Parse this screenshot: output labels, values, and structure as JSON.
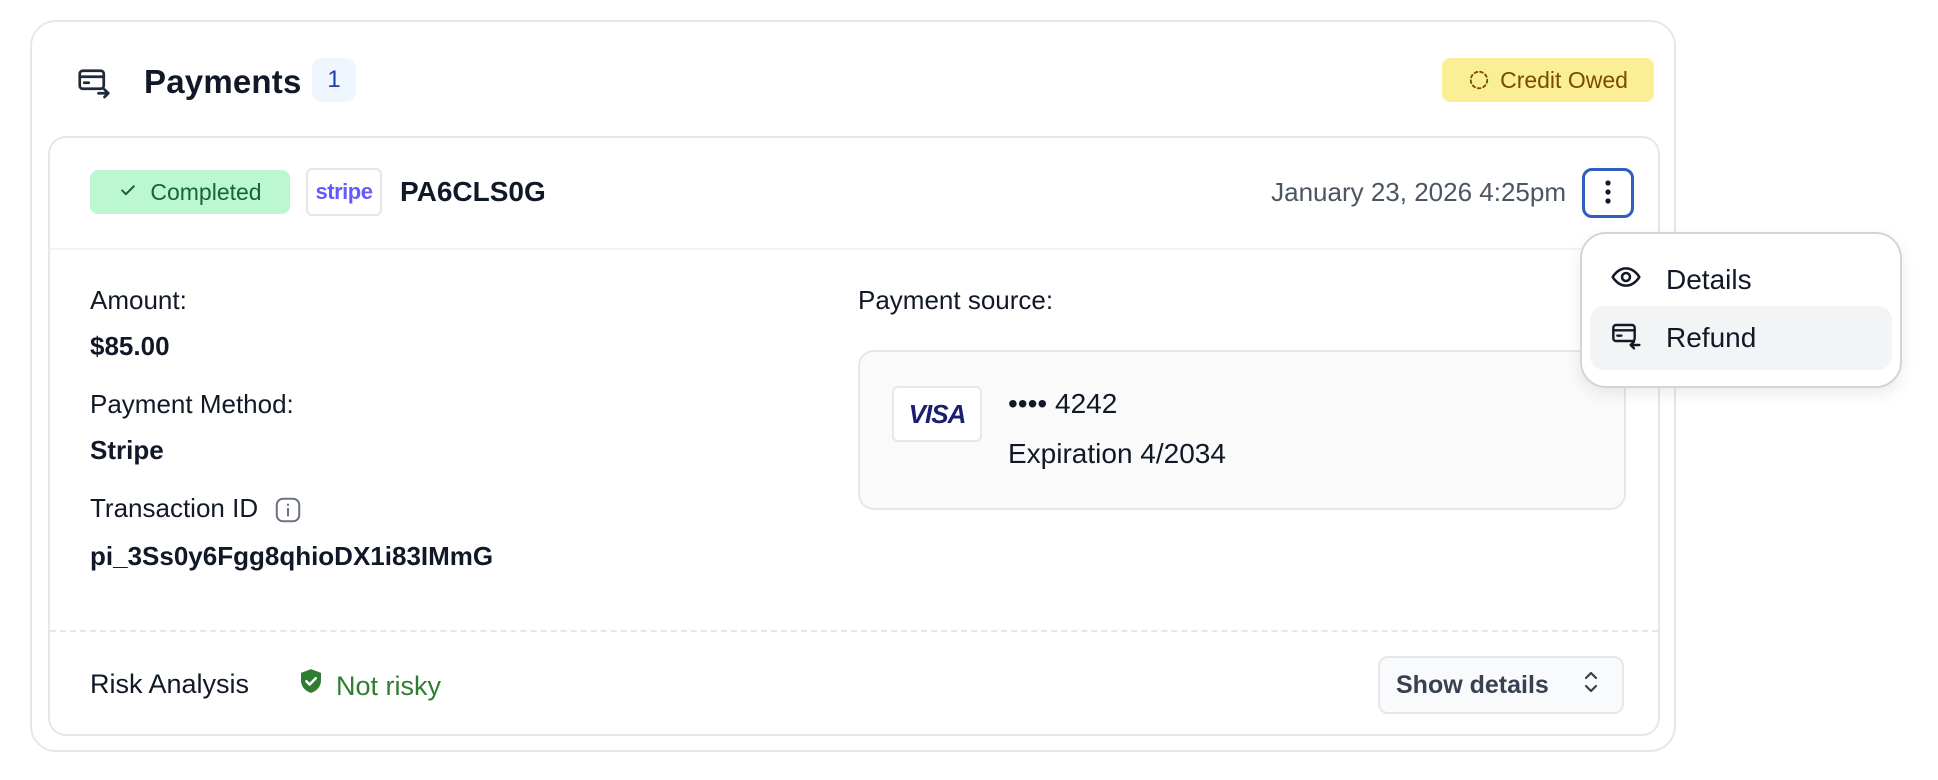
{
  "header": {
    "title": "Payments",
    "count": "1",
    "status_badge": "Credit Owed"
  },
  "payment": {
    "status": "Completed",
    "processor_logo": "stripe",
    "code": "PA6CLS0G",
    "date": "January 23, 2026 4:25pm",
    "amount_label": "Amount:",
    "amount_value": "$85.00",
    "method_label": "Payment Method:",
    "method_value": "Stripe",
    "transaction_label": "Transaction ID",
    "transaction_value": "pi_3Ss0y6Fgg8qhioDX1i83IMmG",
    "source_label": "Payment source:",
    "card_brand": "VISA",
    "card_number": "•••• 4242",
    "card_expiration": "Expiration 4/2034"
  },
  "risk": {
    "label": "Risk Analysis",
    "status": "Not risky",
    "show_details_label": "Show details"
  },
  "menu": {
    "items": [
      {
        "label": "Details",
        "icon": "eye-icon"
      },
      {
        "label": "Refund",
        "icon": "card-refund-icon"
      }
    ]
  },
  "colors": {
    "credit_badge_bg": "#fbef96",
    "completed_badge_bg": "#bbf7d0",
    "not_risky_green": "#2e7d32",
    "focus_blue": "#2f5fbf",
    "stripe_purple": "#635bff",
    "visa_navy": "#1a1f71"
  }
}
